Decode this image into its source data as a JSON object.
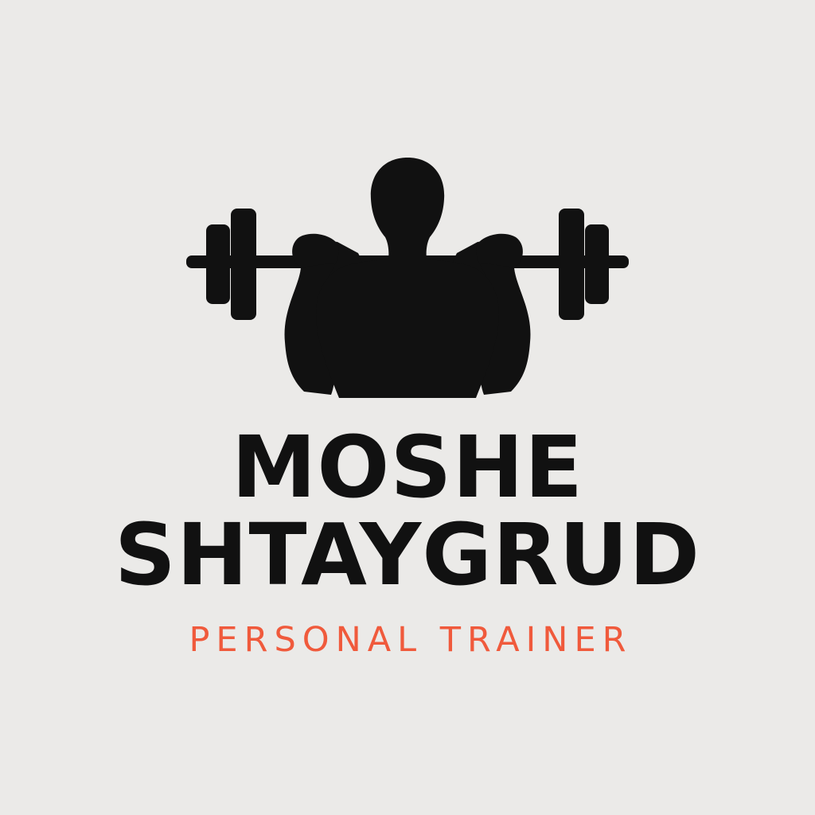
{
  "logo": {
    "emblem_icon": "weightlifter-barbell-icon",
    "name_first": "MOSHE",
    "name_last": "SHTAYGRUD",
    "tagline": "PERSONAL TRAINER"
  },
  "colors": {
    "background": "#ebeae8",
    "primary": "#111111",
    "accent": "#f05a3c"
  }
}
